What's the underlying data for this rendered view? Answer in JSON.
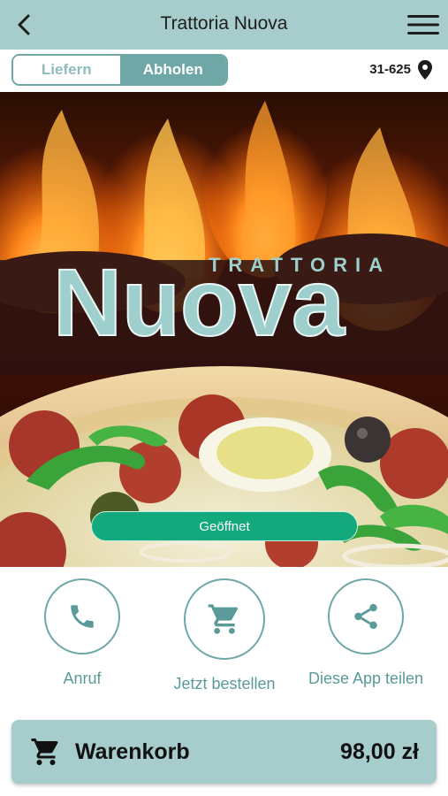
{
  "header": {
    "title": "Trattoria Nuova",
    "back_icon": "chevron-left-icon",
    "menu_icon": "hamburger-menu-icon"
  },
  "delivery_toggle": {
    "options": [
      {
        "label": "Liefern",
        "active": false
      },
      {
        "label": "Abholen",
        "active": true
      }
    ]
  },
  "location": {
    "zip": "31-625",
    "icon": "map-pin-icon"
  },
  "hero": {
    "logo_top": "TRATTORIA",
    "logo_main": "Nuova",
    "status": "Geöffnet"
  },
  "actions": [
    {
      "label": "Anruf",
      "icon": "phone-icon"
    },
    {
      "label": "Jetzt bestellen",
      "icon": "cart-icon"
    },
    {
      "label": "Diese App teilen",
      "icon": "share-icon"
    }
  ],
  "cart": {
    "label": "Warenkorb",
    "price": "98,00 zł",
    "icon": "cart-icon"
  },
  "colors": {
    "header_bg": "#a6cdcb",
    "accent": "#6fa6a6",
    "status_green": "#13a97c",
    "logo_text": "#9fcfcc"
  }
}
